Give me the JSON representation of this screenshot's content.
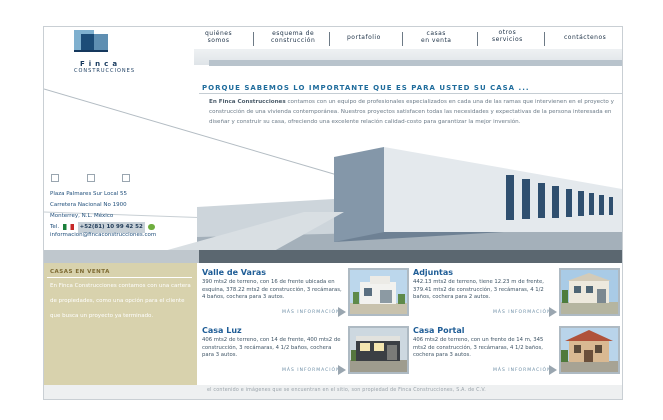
{
  "logo": {
    "name": "Finca",
    "sub": "CONSTRUCCIONES"
  },
  "nav": [
    {
      "line1": "quiénes",
      "line2": "somos"
    },
    {
      "line1": "esquema de",
      "line2": "construcción"
    },
    {
      "line1": "portafolio",
      "line2": ""
    },
    {
      "line1": "casas",
      "line2": "en venta"
    },
    {
      "line1": "otros",
      "line2": "servicios"
    },
    {
      "line1": "contáctenos",
      "line2": ""
    }
  ],
  "headline": "PORQUE SABEMOS LO IMPORTANTE QUE ES PARA USTED SU CASA ...",
  "intro": {
    "brand": "En Finca Construcciones",
    "text": " contamos con un equipo de profesionales especializados en cada una de las ramas que intervienen en el proyecto y construcción de una vivienda contemporánea. Nuestros proyectos satisfacen todas las necesidades y expectativas de la persona interesada en diseñar y construir su casa, ofreciendo una excelente relación calidad-costo para garantizar la mejor inversión."
  },
  "contact": {
    "address1": "Plaza Palmares Sur Local 55",
    "address2": "Carretera Nacional No 1900",
    "city": "Monterrey, N.L. México",
    "tel_label": "Tel.",
    "phone": "+52(81) 10 99 42 52",
    "email": "informacion@fincaconstrucciones.com"
  },
  "panel": {
    "title": "CASAS EN VENTA",
    "text": "En Finca Construcciones contamos con una cartera de propiedades, como una opción para el cliente que busca un proyecto ya terminado."
  },
  "properties": [
    {
      "title": "Valle de Varas",
      "desc": "390 mts2 de terreno, con 16 de frente ubicada en esquina, 378.22 mts2 de construcción, 3 recámaras, 4 baños, cochera para 3 autos.",
      "more": "MÁS INFORMACIÓN"
    },
    {
      "title": "Adjuntas",
      "desc": "442.13 mts2 de terreno, tiene 12.23 m de frente, 379.41 mts2 de construcción, 3 recámaras, 4 1/2 baños, cochera para 2 autos.",
      "more": "MÁS INFORMACIÓN"
    },
    {
      "title": "Casa Luz",
      "desc": "406 mts2 de terreno, con 14 de frente, 400 mts2 de construcción, 3 recámaras, 4 1/2 baños, cochera para 3 autos.",
      "more": "MÁS INFORMACIÓN"
    },
    {
      "title": "Casa Portal",
      "desc": "406 mts2 de terreno, con un frente de 14 m, 345 mts2 de construcción, 3 recámaras, 4 1/2 baños, cochera para 3 autos.",
      "more": "MÁS INFORMACIÓN"
    }
  ],
  "footer": "el contenido e imágenes que se encuentran en el sitio, son propiedad de Finca Construcciones, S.A. de C.V.",
  "colors": {
    "brand_blue": "#1f5d96",
    "panel_sand": "#d8d2ad",
    "dark_band": "#5b6770"
  },
  "icons": [
    "checkbox-square-icon",
    "mexico-flag-icon",
    "go-icon",
    "arrow-right-icon"
  ]
}
